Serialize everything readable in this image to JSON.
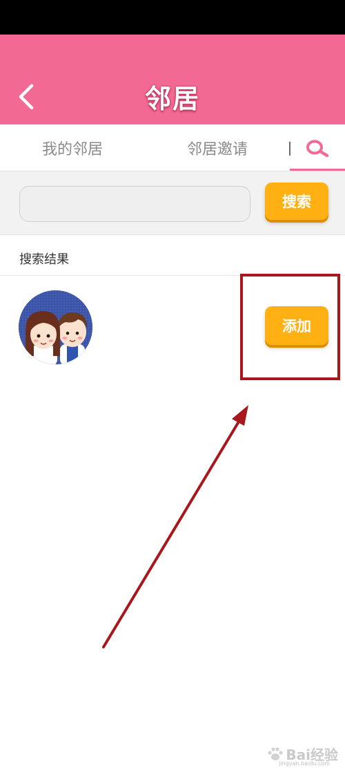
{
  "header": {
    "title": "邻居",
    "back_icon": "chevron-left-icon",
    "background_color": "#f26a93"
  },
  "tabs": {
    "items": [
      {
        "label": "我的邻居"
      },
      {
        "label": "邻居邀请"
      }
    ],
    "search_icon": "search-icon",
    "active": "search"
  },
  "search": {
    "value": "",
    "placeholder": "",
    "button_label": "搜索",
    "button_color": "#ffb114"
  },
  "results": {
    "label": "搜索结果",
    "items": [
      {
        "avatar": "couple-cartoon-avatar",
        "add_label": "添加"
      }
    ]
  },
  "annotation": {
    "color": "#a8171c"
  },
  "watermark": {
    "text": "Bai经验",
    "sub": "jingyan.baidu.com"
  }
}
